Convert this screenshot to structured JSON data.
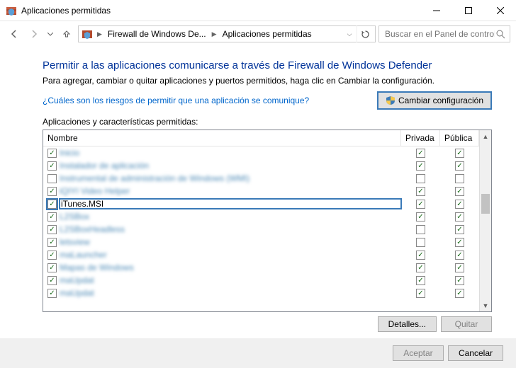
{
  "window": {
    "title": "Aplicaciones permitidas"
  },
  "breadcrumb": {
    "item1": "Firewall de Windows De...",
    "item2": "Aplicaciones permitidas"
  },
  "search": {
    "placeholder": "Buscar en el Panel de control"
  },
  "page": {
    "heading": "Permitir a las aplicaciones comunicarse a través de Firewall de Windows Defender",
    "subtext": "Para agregar, cambiar o quitar aplicaciones y puertos permitidos, haga clic en Cambiar la configuración.",
    "risk_link": "¿Cuáles son los riesgos de permitir que una aplicación se comunique?",
    "change_btn": "Cambiar configuración",
    "table_label": "Aplicaciones y características permitidas:",
    "col_name": "Nombre",
    "col_private": "Privada",
    "col_public": "Pública"
  },
  "rows": [
    {
      "enabled": true,
      "name": "Inicio",
      "private": true,
      "public": true,
      "blur": true,
      "hl": false
    },
    {
      "enabled": true,
      "name": "Instalador de aplicación",
      "private": true,
      "public": true,
      "blur": true,
      "hl": false
    },
    {
      "enabled": false,
      "name": "Instrumental de administración de Windows (WMI)",
      "private": false,
      "public": false,
      "blur": true,
      "hl": false
    },
    {
      "enabled": true,
      "name": "iQIYI Video Helper",
      "private": true,
      "public": true,
      "blur": true,
      "hl": false
    },
    {
      "enabled": true,
      "name": "iTunes.MSI",
      "private": true,
      "public": true,
      "blur": false,
      "hl": true
    },
    {
      "enabled": true,
      "name": "L2SBox",
      "private": true,
      "public": true,
      "blur": true,
      "hl": false
    },
    {
      "enabled": true,
      "name": "L2SBoxHeadless",
      "private": false,
      "public": true,
      "blur": true,
      "hl": false
    },
    {
      "enabled": true,
      "name": "letsview",
      "private": false,
      "public": true,
      "blur": true,
      "hl": false
    },
    {
      "enabled": true,
      "name": "maLauncher",
      "private": true,
      "public": true,
      "blur": true,
      "hl": false
    },
    {
      "enabled": true,
      "name": "Mapas de Windows",
      "private": true,
      "public": true,
      "blur": true,
      "hl": false
    },
    {
      "enabled": true,
      "name": "maUpdat",
      "private": true,
      "public": true,
      "blur": true,
      "hl": false
    },
    {
      "enabled": true,
      "name": "maUpdat",
      "private": true,
      "public": true,
      "blur": true,
      "hl": false
    }
  ],
  "buttons": {
    "details": "Detalles...",
    "remove": "Quitar",
    "ok": "Aceptar",
    "cancel": "Cancelar"
  }
}
